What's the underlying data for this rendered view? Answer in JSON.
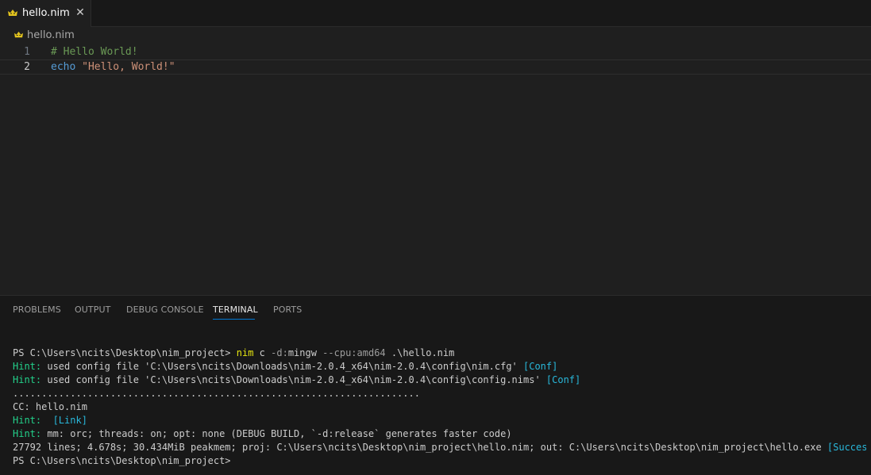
{
  "tab": {
    "label": "hello.nim",
    "close_glyph": "✕",
    "icon": "nim-crown-icon",
    "icon_color": "#e2c31e"
  },
  "breadcrumb": {
    "label": "hello.nim"
  },
  "editor": {
    "lines": [
      {
        "number": "1",
        "comment": "# Hello World!"
      },
      {
        "number": "2",
        "keyword": "echo",
        "space": " ",
        "string": "\"Hello, World!\""
      }
    ]
  },
  "panel": {
    "tabs": [
      "PROBLEMS",
      "OUTPUT",
      "DEBUG CONSOLE",
      "TERMINAL",
      "PORTS"
    ],
    "active_tab": "TERMINAL",
    "accent_color": "#0078d4"
  },
  "terminal": {
    "line1": {
      "prompt": "PS C:\\Users\\ncits\\Desktop\\nim_project> ",
      "cmd": "nim",
      "c": " c ",
      "arg1": "-d:",
      "arg1b": "mingw",
      "arg2": " --cpu:amd64 ",
      "file": ".\\hello.nim"
    },
    "line2": {
      "hint": "Hint:",
      "text": " used config file 'C:\\Users\\ncits\\Downloads\\nim-2.0.4_x64\\nim-2.0.4\\config\\nim.cfg' ",
      "tag": "[Conf]"
    },
    "line3": {
      "hint": "Hint:",
      "text": " used config file 'C:\\Users\\ncits\\Downloads\\nim-2.0.4_x64\\nim-2.0.4\\config\\config.nims' ",
      "tag": "[Conf]"
    },
    "line4": {
      "dots": "......................................................................."
    },
    "line5": {
      "text": "CC: hello.nim"
    },
    "line6": {
      "hint": "Hint:",
      "text": "  ",
      "tag": "[Link]"
    },
    "line7": {
      "hint": "Hint:",
      "text": " mm: orc; threads: on; opt: none (DEBUG BUILD, `-d:release` generates faster code)"
    },
    "line8": {
      "text": "27792 lines; 4.678s; 30.434MiB peakmem; proj: C:\\Users\\ncits\\Desktop\\nim_project\\hello.nim; out: C:\\Users\\ncits\\Desktop\\nim_project\\hello.exe ",
      "tag": "[SuccessX]"
    },
    "line9": {
      "prompt": "PS C:\\Users\\ncits\\Desktop\\nim_project>"
    }
  },
  "colors": {
    "hint": "#23d18b",
    "tag": "#29b8db",
    "command": "#e5e510",
    "comment": "#6a9955",
    "keyword": "#569cd6",
    "string": "#ce9178"
  }
}
